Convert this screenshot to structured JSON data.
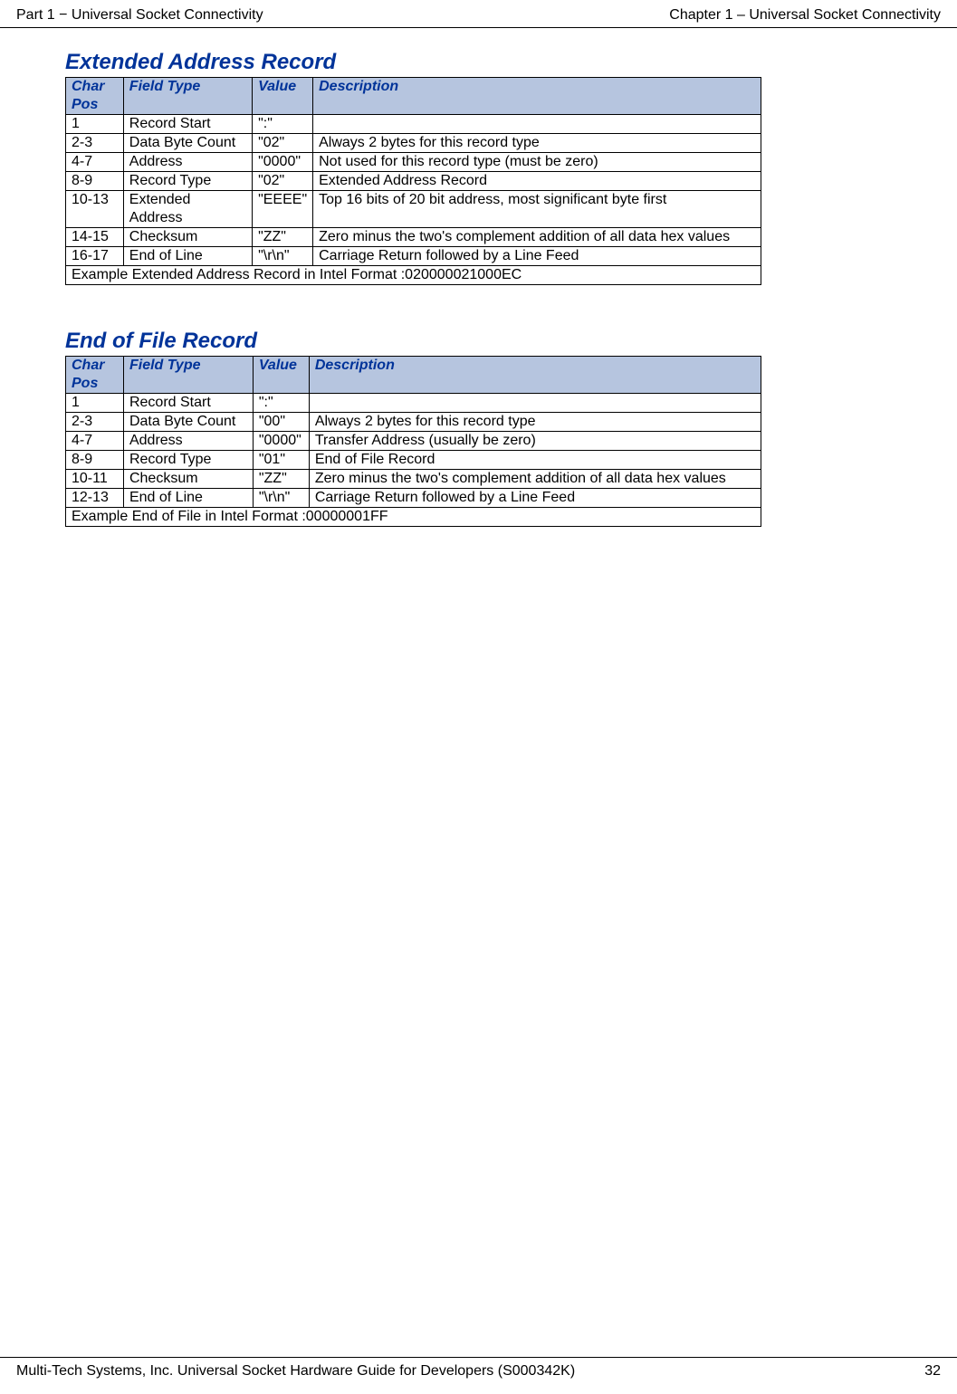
{
  "header": {
    "left": "Part 1 − Universal Socket Connectivity",
    "right": "Chapter 1 – Universal Socket Connectivity"
  },
  "section1": {
    "title": "Extended Address Record",
    "columns": [
      "Char Pos",
      "Field Type",
      "Value",
      "Description"
    ],
    "rows": [
      {
        "pos": "1",
        "ftype": "Record Start",
        "val": "\":\"",
        "desc": ""
      },
      {
        "pos": "2-3",
        "ftype": "Data Byte Count",
        "val": "\"02\"",
        "desc": "Always 2 bytes for this record type"
      },
      {
        "pos": "4-7",
        "ftype": "Address",
        "val": "\"0000\"",
        "desc": "Not used for this record type (must be zero)"
      },
      {
        "pos": "8-9",
        "ftype": "Record Type",
        "val": "\"02\"",
        "desc": "Extended Address Record"
      },
      {
        "pos": "10-13",
        "ftype": "Extended Address",
        "val": "\"EEEE\"",
        "desc": "Top 16 bits of 20 bit address, most significant byte first"
      },
      {
        "pos": "14-15",
        "ftype": "Checksum",
        "val": "\"ZZ\"",
        "desc": "Zero minus the two's complement addition of all data hex values"
      },
      {
        "pos": "16-17",
        "ftype": "End of Line",
        "val": "\"\\r\\n\"",
        "desc": "Carriage Return followed by a Line Feed"
      }
    ],
    "example": "Example Extended Address Record in Intel Format :020000021000EC"
  },
  "section2": {
    "title": "End of File Record",
    "columns": [
      "Char Pos",
      "Field Type",
      "Value",
      "Description"
    ],
    "rows": [
      {
        "pos": "1",
        "ftype": "Record Start",
        "val": "\":\"",
        "desc": ""
      },
      {
        "pos": "2-3",
        "ftype": "Data Byte Count",
        "val": "\"00\"",
        "desc": "Always 2 bytes for this record type"
      },
      {
        "pos": "4-7",
        "ftype": "Address",
        "val": "\"0000\"",
        "desc": "Transfer Address (usually be zero)"
      },
      {
        "pos": "8-9",
        "ftype": "Record Type",
        "val": "\"01\"",
        "desc": "End of File Record"
      },
      {
        "pos": "10-11",
        "ftype": "Checksum",
        "val": "\"ZZ\"",
        "desc": "Zero minus the two's complement addition of all data hex values"
      },
      {
        "pos": "12-13",
        "ftype": "End of Line",
        "val": "\"\\r\\n\"",
        "desc": "Carriage Return followed by a Line Feed"
      }
    ],
    "example": "Example End of File in Intel Format :00000001FF"
  },
  "footer": {
    "left": "Multi-Tech Systems, Inc. Universal Socket Hardware Guide for Developers (S000342K)",
    "right": "32"
  }
}
